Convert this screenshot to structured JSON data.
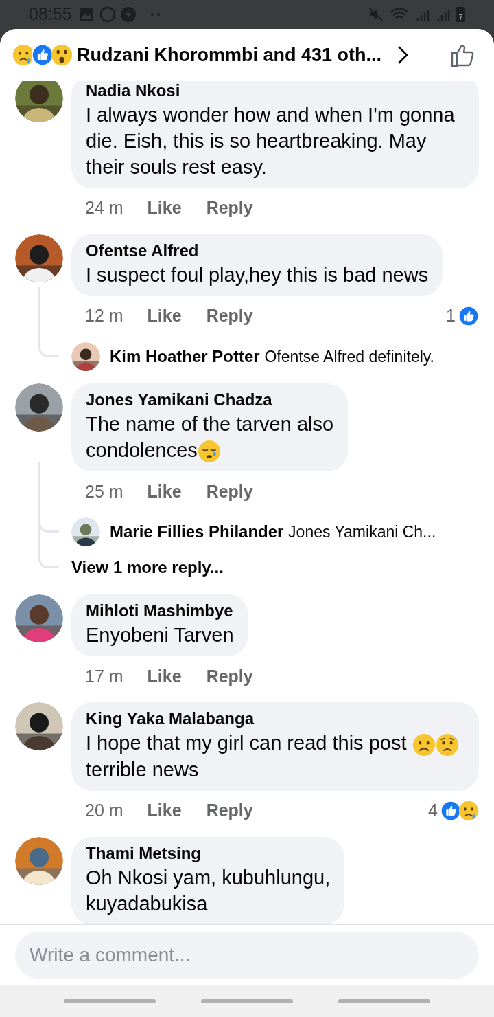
{
  "status_bar": {
    "time": "08:55",
    "battery": "7"
  },
  "header": {
    "reactions": [
      {
        "kind": "sad"
      },
      {
        "kind": "like"
      },
      {
        "kind": "wow"
      }
    ],
    "title": "Rudzani Khorommbi and 431 oth..."
  },
  "comments": [
    {
      "name": "Nadia Nkosi",
      "body": [
        {
          "kind": "text",
          "text": "I always wonder how and when I'm gonna die. Eish, this is so heartbreaking. May their souls rest easy."
        }
      ],
      "time": "24 m",
      "like": "Like",
      "reply": "Reply"
    },
    {
      "name": "Ofentse Alfred",
      "body": [
        {
          "kind": "text",
          "text": "I suspect foul play,hey this is bad news"
        }
      ],
      "time": "12 m",
      "like": "Like",
      "reply": "Reply",
      "reaction_count": "1",
      "reaction_icons": [
        {
          "kind": "like"
        }
      ],
      "replies": [
        {
          "name": "Kim Hoather Potter",
          "text": "Ofentse Alfred definitely."
        }
      ]
    },
    {
      "name": "Jones Yamikani Chadza",
      "body": [
        {
          "kind": "text",
          "text": "The name of the tarven also\ncondolences"
        },
        {
          "kind": "sleepy"
        }
      ],
      "time": "25 m",
      "like": "Like",
      "reply": "Reply",
      "replies": [
        {
          "name": "Marie Fillies Philander",
          "text": "Jones Yamikani Ch..."
        }
      ],
      "more_replies": "View 1 more reply..."
    },
    {
      "name": "Mihloti Mashimbye",
      "body": [
        {
          "kind": "text",
          "text": "Enyobeni Tarven"
        }
      ],
      "time": "17 m",
      "like": "Like",
      "reply": "Reply"
    },
    {
      "name": "King Yaka Malabanga",
      "body": [
        {
          "kind": "text",
          "text": "I hope that my girl can read this post "
        },
        {
          "kind": "frown"
        },
        {
          "kind": "worried"
        },
        {
          "kind": "text",
          "text": "terrible news"
        }
      ],
      "time": "20 m",
      "like": "Like",
      "reply": "Reply",
      "reaction_count": "4",
      "reaction_icons": [
        {
          "kind": "like"
        },
        {
          "kind": "sad"
        }
      ]
    },
    {
      "name": "Thami Metsing",
      "body": [
        {
          "kind": "text",
          "text": "Oh Nkosi yam, kubuhlungu,\nkuyadabukisa"
        }
      ]
    }
  ],
  "composer": {
    "placeholder": "Write a comment..."
  }
}
